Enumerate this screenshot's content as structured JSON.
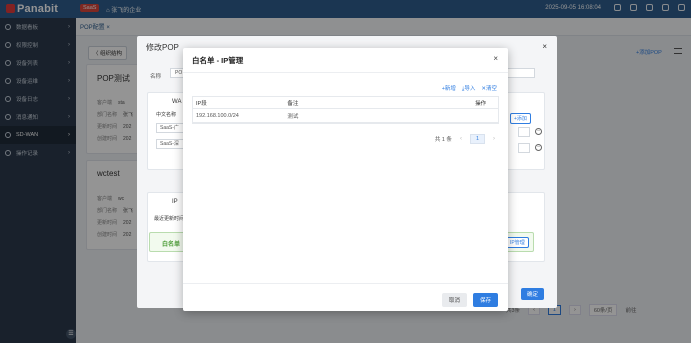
{
  "topbar": {
    "logo": "Panabit",
    "badge": "SaaS",
    "tenant": "张飞的企业",
    "datetime": "2025-09-05 16:08:04"
  },
  "sidebar": {
    "items": [
      {
        "label": "数据看板"
      },
      {
        "label": "权限控制"
      },
      {
        "label": "设备列表"
      },
      {
        "label": "设备运维"
      },
      {
        "label": "设备日志"
      },
      {
        "label": "消息通知"
      },
      {
        "label": "SD-WAN"
      },
      {
        "label": "操作记录"
      }
    ]
  },
  "tabbar": {
    "tab": "POP配置 ×"
  },
  "main": {
    "back": "〈 组织结构",
    "add_pop": "+添加POP",
    "card1_title": "POP测试",
    "card1_rows": [
      {
        "k": "客户端",
        "v": "sta"
      },
      {
        "k": "部门名称",
        "v": "张飞"
      },
      {
        "k": "更新时间",
        "v": "202"
      },
      {
        "k": "创建时间",
        "v": "202"
      }
    ],
    "card2_title": "wctest",
    "card2_rows": [
      {
        "k": "客户端",
        "v": "wc"
      },
      {
        "k": "部门名称",
        "v": "张飞"
      },
      {
        "k": "更新时间",
        "v": "202"
      },
      {
        "k": "创建时间",
        "v": "202"
      }
    ],
    "pager_total": "共3条",
    "pager_page": "1",
    "pager_size": "60条/页",
    "pager_goto": "前往"
  },
  "edit_dialog": {
    "title": "修改POP",
    "name_label": "名称",
    "name_value": "PO",
    "sec1_label": "WA",
    "cn_name_label": "中文名称",
    "saas1": "SaaS-广",
    "saas2": "SaaS-深",
    "add_btn": "+添加",
    "sec2_label": "IP",
    "recent_label": "最近更新时间",
    "whitelist": "白名单",
    "whitelist_mgr": "IP管理",
    "confirm": "确定"
  },
  "ip_modal": {
    "title": "白名单 - IP管理",
    "actions": {
      "add": "+新增",
      "import": "导入",
      "clear": "清空"
    },
    "columns": {
      "ip": "IP段",
      "note": "备注",
      "op": "操作"
    },
    "rows": [
      {
        "ip": "192.168.100.0/24",
        "note": "测试",
        "op": ""
      }
    ],
    "pager": {
      "total": "共 1 条",
      "page": "1"
    },
    "cancel": "取消",
    "save": "保存"
  }
}
